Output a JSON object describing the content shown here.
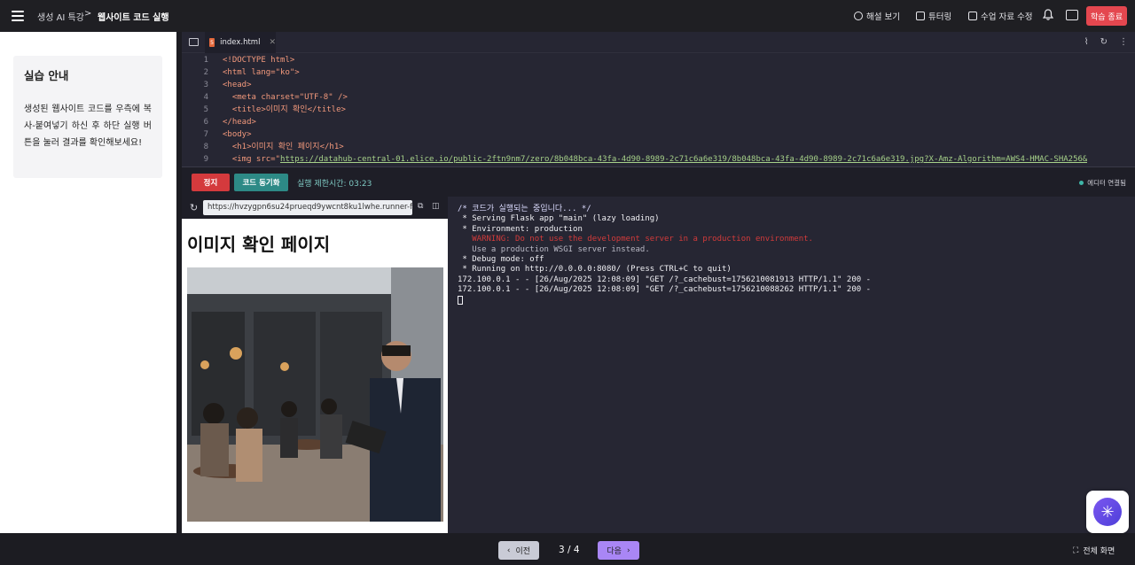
{
  "header": {
    "breadcrumb_course": "생성 AI 특강",
    "breadcrumb_separator": ">",
    "breadcrumb_current": "웹사이트 코드 실행",
    "solution_label": "해설 보기",
    "tutoring_label": "튜터링",
    "edit_material_label": "수업 자료 수정",
    "end_button": "학습 종료"
  },
  "guide": {
    "title": "실습 안내",
    "text": "생성된 웹사이트 코드를 우측에 복사-붙여넣기 하신 후 하단 실행 버튼을 눌러 결과를 확인해보세요!"
  },
  "editor": {
    "file_name": "index.html",
    "line_numbers": [
      "1",
      "2",
      "3",
      "4",
      "5",
      "6",
      "7",
      "8",
      "9"
    ],
    "lines": [
      {
        "a": "<!DOCTYPE html>"
      },
      {
        "a": "<html lang=\"ko\">"
      },
      {
        "a": "<head>"
      },
      {
        "a": "  <meta charset=\"UTF-8\" />"
      },
      {
        "a": "  <title>이미지 확인</title>"
      },
      {
        "a": "</head>"
      },
      {
        "a": "<body>"
      },
      {
        "a": "  <h1>이미지 확인 페이지</h1>"
      },
      {
        "a": "  <img src=\"",
        "url": "https://datahub-central-01.elice.io/public-2ftn9nm7/zero/8b048bca-43fa-4d90-8989-2c71c6a6e319/8b048bca-43fa-4d90-8989-2c71c6a6e319.jpg?X-Amz-Algorithm=AWS4-HMAC-SHA256&"
      }
    ]
  },
  "controls": {
    "stop_label": "정지",
    "sync_label": "코드 동기화",
    "timer_text": "실행 제한시간: 03:23",
    "connection_status": "에디터 연결됨"
  },
  "browser": {
    "url": "https://hvzygpn6su24prueqd9ywcnt8ku1lwhe.runner-fo",
    "page_heading": "이미지 확인 페이지"
  },
  "terminal": {
    "lines": [
      {
        "text": "/* 코드가 실행되는 중입니다... */",
        "kind": "cmt"
      },
      {
        "text": " * Serving Flask app \"main\" (lazy loading)",
        "kind": "normal"
      },
      {
        "text": " * Environment: production",
        "kind": "normal"
      },
      {
        "text": "   WARNING: Do not use the development server in a production environment.",
        "kind": "warn"
      },
      {
        "text": "   Use a production WSGI server instead.",
        "kind": "dim"
      },
      {
        "text": " * Debug mode: off",
        "kind": "normal"
      },
      {
        "text": " * Running on http://0.0.0.0:8080/ (Press CTRL+C to quit)",
        "kind": "normal"
      },
      {
        "text": "172.100.0.1 - - [26/Aug/2025 12:08:09] \"GET /?_cachebust=1756210081913 HTTP/1.1\" 200 -",
        "kind": "normal"
      },
      {
        "text": "172.100.0.1 - - [26/Aug/2025 12:08:09] \"GET /?_cachebust=1756210088262 HTTP/1.1\" 200 -",
        "kind": "normal"
      }
    ]
  },
  "footer": {
    "prev_label": "이전",
    "page_indicator": "3 / 4",
    "next_label": "다음",
    "fullscreen_label": "전체 화면"
  },
  "colors": {
    "end_button": "#e4474f",
    "stop_button": "#d43a3d",
    "sync_button": "#2d8a86",
    "next_button": "#a986f5",
    "ai_button": "#6b4ce6"
  }
}
